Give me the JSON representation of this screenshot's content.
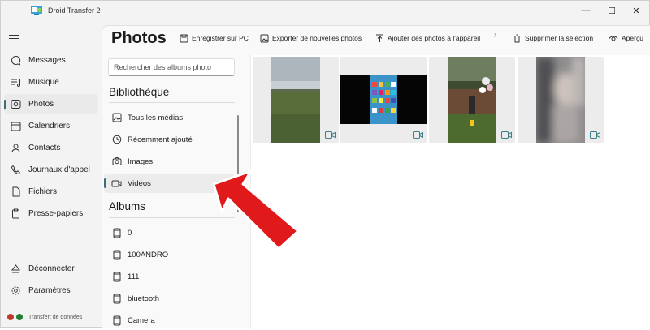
{
  "app": {
    "title": "Droid Transfer 2"
  },
  "window_controls": {
    "minimize": "—",
    "maximize": "☐",
    "close": "✕"
  },
  "nav": {
    "items": [
      {
        "label": "Messages",
        "icon": "message-icon"
      },
      {
        "label": "Musique",
        "icon": "music-icon"
      },
      {
        "label": "Photos",
        "icon": "photos-icon",
        "active": true
      },
      {
        "label": "Calendriers",
        "icon": "calendar-icon"
      },
      {
        "label": "Contacts",
        "icon": "contacts-icon"
      },
      {
        "label": "Journaux d'appel",
        "icon": "phone-icon"
      },
      {
        "label": "Fichiers",
        "icon": "file-icon"
      },
      {
        "label": "Presse-papiers",
        "icon": "clipboard-icon"
      }
    ],
    "bottom": [
      {
        "label": "Déconnecter",
        "icon": "disconnect-icon"
      },
      {
        "label": "Paramètres",
        "icon": "gear-icon"
      }
    ],
    "status": {
      "text": "Transfert de données",
      "colors": [
        "#c0392b",
        "#1e7e34"
      ]
    }
  },
  "page": {
    "title": "Photos"
  },
  "toolbar": {
    "save_pc": "Enregistrer sur PC",
    "export_new": "Exporter de nouvelles photos",
    "add_device": "Ajouter des photos à l'appareil",
    "delete_selection": "Supprimer la sélection",
    "preview": "Aperçu"
  },
  "albums_panel": {
    "search_placeholder": "Rechercher des albums photo",
    "library_heading": "Bibliothèque",
    "library": [
      {
        "label": "Tous les médias",
        "icon": "image-icon"
      },
      {
        "label": "Récemment ajouté",
        "icon": "clock-icon"
      },
      {
        "label": "Images",
        "icon": "camera-icon"
      },
      {
        "label": "Vidéos",
        "icon": "video-icon",
        "active": true
      }
    ],
    "albums_heading": "Albums",
    "albums": [
      {
        "label": "0"
      },
      {
        "label": "100ANDRO"
      },
      {
        "label": "111"
      },
      {
        "label": "bluetooth"
      },
      {
        "label": "Camera"
      }
    ]
  },
  "gallery": {
    "items": [
      {
        "kind": "video",
        "scene": "field-landscape"
      },
      {
        "kind": "video",
        "scene": "phone-screen-recording"
      },
      {
        "kind": "video",
        "scene": "garden-balloons"
      },
      {
        "kind": "video",
        "scene": "blurred-portrait"
      }
    ]
  },
  "colors": {
    "accent": "#3a6f77",
    "annotation_arrow": "#e0191b"
  }
}
